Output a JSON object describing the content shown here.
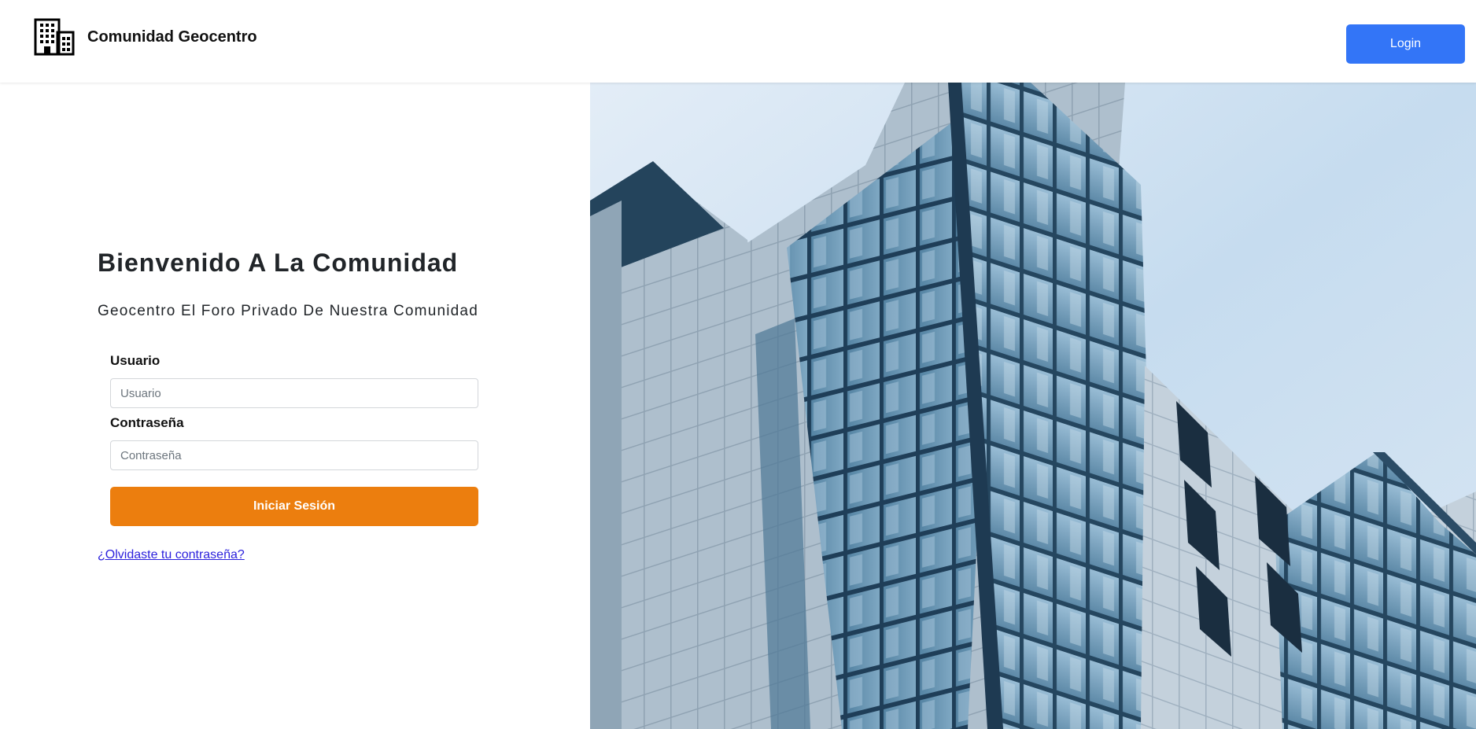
{
  "navbar": {
    "brand_icon": "building-icon",
    "brand_name": "Comunidad Geocentro",
    "login_label": "Login"
  },
  "hero": {
    "title": "Bienvenido A La Comunidad",
    "subtitle": "Geocentro El Foro Privado De Nuestra Comunidad"
  },
  "form": {
    "username_label": "Usuario",
    "username_placeholder": "Usuario",
    "username_value": "",
    "password_label": "Contraseña",
    "password_placeholder": "Contraseña",
    "password_value": "",
    "submit_label": "Iniciar Sesión",
    "forgot_label": "¿Olvidaste tu contraseña?"
  },
  "image": {
    "subject": "modern-glass-building-photo"
  },
  "colors": {
    "primary_blue": "#3375f7",
    "accent_orange": "#ec7e0e",
    "link": "#2a1fdc"
  }
}
